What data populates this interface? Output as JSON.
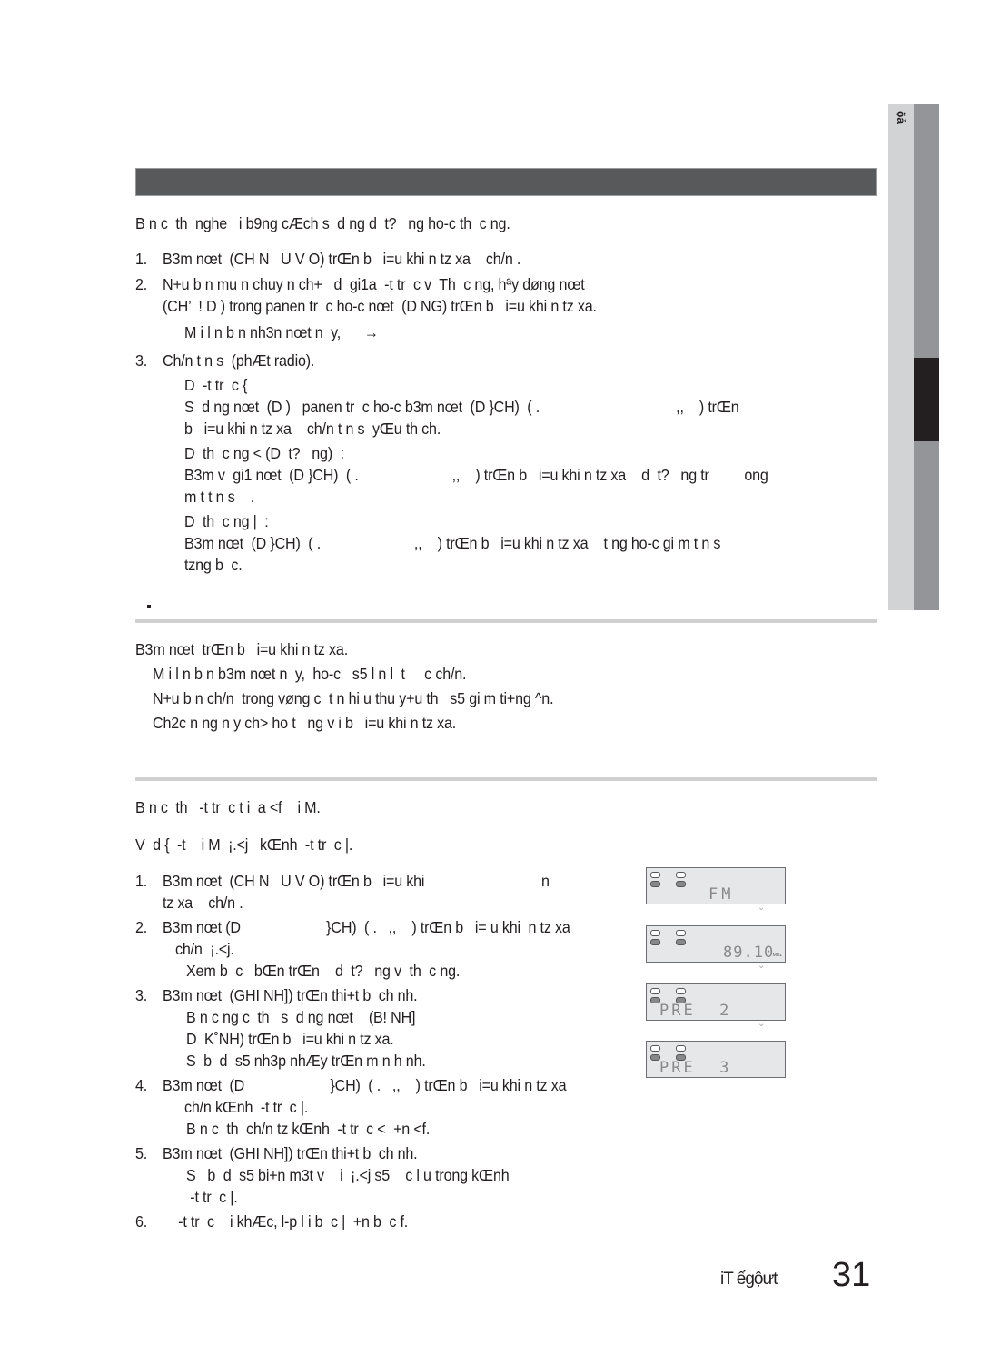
{
  "side_tab": {
    "label": "ọ̈ả"
  },
  "section1": {
    "intro": "B n c  th  nghe   i b9ng cÆch s  d ng d  t?   ng ho-c th  c ng.",
    "steps": [
      {
        "num": "1.",
        "lines": [
          "B3m nœt  (CH N   U V O) trŒn b   i=u khi n tz xa    ch/n ."
        ]
      },
      {
        "num": "2.",
        "lines": [
          "N+u b n mu n chuy n ch+   d  gi1a  -t tr  c v  Th  c ng, hªy døng nœt",
          "(CH’  ! D ) trong panen tr  c ho-c nœt  (D NG) trŒn b   i=u khi n tz xa."
        ]
      },
      {
        "num": "",
        "lines": [
          "M i l n b n nh3n nœt n  y,      →"
        ]
      },
      {
        "num": "3.",
        "lines": [
          "Ch/n t n s  (phÆt radio)."
        ]
      }
    ],
    "sub_items": [
      "D  -t tr  c {",
      "S  d ng nœt  (D )   panen tr  c ho-c b3m nœt  (D }CH)  ( .                                   ,,    ) trŒn",
      "b   i=u khi n tz xa    ch/n t n s  yŒu th ch.",
      "D  th  c ng < (D  t?   ng)  :",
      "B3m v  gi1 nœt  (D }CH)  ( .                        ,,    ) trŒn b   i=u khi n tz xa    d  t?   ng tr         ong",
      "m t t n s    .",
      "D  th  c ng |  :",
      "B3m nœt  (D }CH)  ( .                        ,,    ) trŒn b   i=u khi n tz xa    t ng ho-c gi m t n s",
      "tzng b  c."
    ]
  },
  "section2": {
    "lines": [
      "B3m nœt  trŒn b   i=u khi n tz xa.",
      "M i l n b n b3m nœt n  y,  ho-c   s5 l n l  t     c ch/n.",
      "N+u b n ch/n  trong vøng c  t n hi u thu y+u th   s5 gi m ti+ng ^n.",
      "Ch2c n ng n y ch> ho t   ng v i b   i=u khi n tz xa."
    ]
  },
  "section3": {
    "intro": "B n c  th   -t tr  c t i  a <f    i M.",
    "example": "V  d {  -t    i M  ¡.<j   kŒnh  -t tr  c |.",
    "steps": [
      {
        "num": "1.",
        "lines": [
          "B3m nœt  (CH N   U V O) trŒn b   i=u khi                              n",
          "tz xa    ch/n ."
        ]
      },
      {
        "num": "2.",
        "lines": [
          "B3m nœt (D                      }CH)  ( .   ,,    ) trŒn b   i= u khi  n tz xa",
          "ch/n  ¡.<j."
        ],
        "sub": [
          "Xem b  c   bŒn trŒn    d  t?   ng v  th  c ng."
        ]
      },
      {
        "num": "3.",
        "lines": [
          "B3m nœt  (GHI NH]) trŒn thi+t b  ch nh."
        ],
        "sub": [
          "B n c ng c  th   s  d ng nœt    (B! NH]",
          "D  K˚NH) trŒn b   i=u khi n tz xa.",
          "S  b  d  s5 nh3p nhÆy trŒn m n h nh."
        ]
      },
      {
        "num": "4.",
        "lines": [
          "B3m nœt  (D                      }CH)  ( .   ,,    ) trŒn b   i=u khi n tz xa",
          "ch/n kŒnh  -t tr  c |."
        ],
        "sub": [
          "B n c  th  ch/n tz kŒnh  -t tr  c <  +n <f."
        ]
      },
      {
        "num": "5.",
        "lines": [
          "B3m nœt  (GHI NH]) trŒn thi+t b  ch nh."
        ],
        "sub": [
          "S   b  d  s5 bi+n m3t v    i  ¡.<j s5    c l u trong kŒnh",
          " -t tr  c |."
        ]
      },
      {
        "num": "6.",
        "lines": [
          "    -t tr  c    i khÆc, l-p l i b  c |  +n b  c f."
        ]
      }
    ],
    "displays": [
      {
        "text": "FM",
        "unit": ""
      },
      {
        "text": "89.10",
        "unit": "MHz"
      },
      {
        "text": "PRE  2",
        "unit": ""
      },
      {
        "text": "PRE  3",
        "unit": ""
      }
    ]
  },
  "footer": {
    "language": "iT ếgộưt",
    "page_number": "31"
  }
}
